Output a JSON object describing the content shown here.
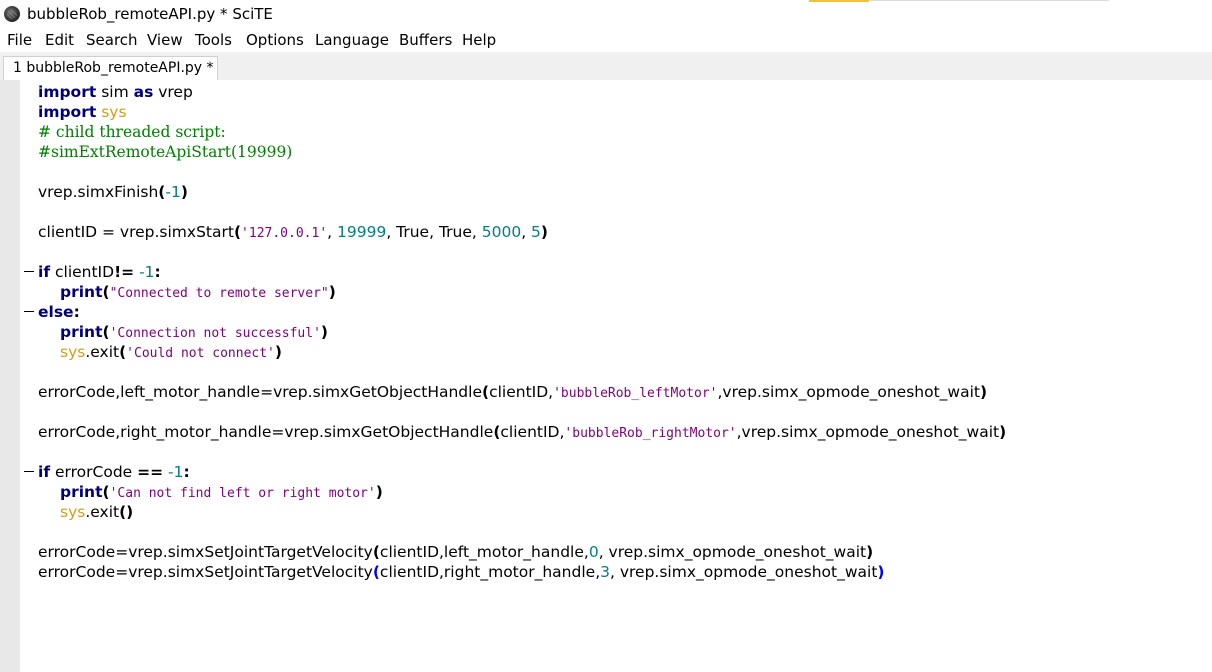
{
  "window": {
    "title": "bubbleRob_remoteAPI.py * SciTE",
    "icon": "scite-app-icon"
  },
  "menu": [
    "File",
    "Edit",
    "Search",
    "View",
    "Tools",
    "Options",
    "Language",
    "Buffers",
    "Help"
  ],
  "tabs": [
    {
      "label": "1 bubbleRob_remoteAPI.py *",
      "active": true
    }
  ],
  "colors": {
    "keyword": "#00007f",
    "number": "#007f7f",
    "string": "#7f007f",
    "comment": "#007f00",
    "module": "#cfa019",
    "margin": "#e8e8e8"
  },
  "code": {
    "l1": {
      "kw1": "import",
      "t1": " sim ",
      "kw2": "as",
      "t2": " vrep"
    },
    "l2": {
      "kw1": "import",
      "t1": " ",
      "mod": "sys"
    },
    "l3": {
      "cmt": "# child threaded script:"
    },
    "l4": {
      "cmt": "#simExtRemoteApiStart(19999)"
    },
    "l6": {
      "t1": "vrep.simxFinish",
      "p1": "(",
      "n1": "-1",
      "p2": ")"
    },
    "l8": {
      "t1": "clientID = vrep.simxStart",
      "p1": "(",
      "s1": "'127.0.0.1'",
      "t2": ", ",
      "n1": "19999",
      "t3": ", True, True, ",
      "n2": "5000",
      "t4": ", ",
      "n3": "5",
      "p2": ")"
    },
    "l10": {
      "kw1": "if",
      "t1": " clientID",
      "op1": "!=",
      "t2": " ",
      "n1": "-1",
      "op2": ":"
    },
    "l11": {
      "kw1": "print",
      "p1": "(",
      "s1": "\"Connected to remote server\"",
      "p2": ")"
    },
    "l12": {
      "kw1": "else",
      "op1": ":"
    },
    "l13": {
      "kw1": "print",
      "p1": "(",
      "s1": "'Connection not successful'",
      "p2": ")"
    },
    "l14": {
      "mod": "sys",
      "t1": ".exit",
      "p1": "(",
      "s1": "'Could not connect'",
      "p2": ")"
    },
    "l16": {
      "t1": "errorCode,left_motor_handle=vrep.simxGetObjectHandle",
      "p1": "(",
      "t2": "clientID,",
      "s1": "'bubbleRob_leftMotor'",
      "t3": ",vrep.simx_opmode_oneshot_wait",
      "p2": ")"
    },
    "l18": {
      "t1": "errorCode,right_motor_handle=vrep.simxGetObjectHandle",
      "p1": "(",
      "t2": "clientID,",
      "s1": "'bubbleRob_rightMotor'",
      "t3": ",vrep.simx_opmode_oneshot_wait",
      "p2": ")"
    },
    "l20": {
      "kw1": "if",
      "t1": " errorCode ",
      "op1": "==",
      "t2": " ",
      "n1": "-1",
      "op2": ":"
    },
    "l21": {
      "kw1": "print",
      "p1": "(",
      "s1": "'Can not find left or right motor'",
      "p2": ")"
    },
    "l22": {
      "mod": "sys",
      "t1": ".exit",
      "p1": "()"
    },
    "l24": {
      "t1": "errorCode=vrep.simxSetJointTargetVelocity",
      "p1": "(",
      "t2": "clientID,left_motor_handle,",
      "n1": "0",
      "t3": ", vrep.simx_opmode_oneshot_wait",
      "p2": ")"
    },
    "l25": {
      "t1": "errorCode=vrep.simxSetJointTargetVelocity",
      "p1": "(",
      "t2": "clientID,right_motor_handle,",
      "n1": "3",
      "t3": ", vrep.simx_opmode_oneshot_wait",
      "p2": ")"
    }
  }
}
